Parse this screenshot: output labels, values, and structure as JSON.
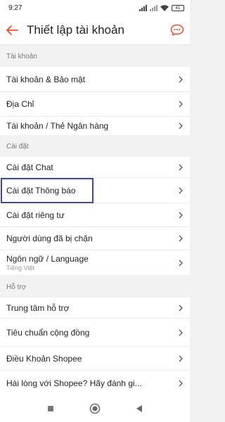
{
  "status_bar": {
    "time": "9:27",
    "battery": "41"
  },
  "app_bar": {
    "title": "Thiết lập tài khoản",
    "back_icon": "back-arrow-icon",
    "chat_icon": "chat-bubble-icon"
  },
  "colors": {
    "accent": "#ee4d2d",
    "highlight": "#3b4a9f"
  },
  "sections": {
    "account": {
      "header": "Tài khoản",
      "items": [
        {
          "label": "Tài khoản & Bảo mật"
        },
        {
          "label": "Địa Chỉ"
        },
        {
          "label": "Tài khoản / Thẻ Ngân hàng"
        }
      ]
    },
    "settings": {
      "header": "Cài đặt",
      "items": [
        {
          "label": "Cài đặt Chat"
        },
        {
          "label": "Cài đặt Thông báo"
        },
        {
          "label": "Cài đặt riêng tư"
        },
        {
          "label": "Người dùng đã bị chặn"
        },
        {
          "label": "Ngôn ngữ / Language",
          "sub": "Tiếng Việt"
        }
      ]
    },
    "support": {
      "header": "Hỗ trợ",
      "items": [
        {
          "label": "Trung tâm hỗ trợ"
        },
        {
          "label": "Tiêu chuẩn cộng đồng"
        },
        {
          "label": "Điều Khoản Shopee"
        },
        {
          "label": "Hài lòng với Shopee? Hãy đánh gi..."
        }
      ]
    }
  }
}
